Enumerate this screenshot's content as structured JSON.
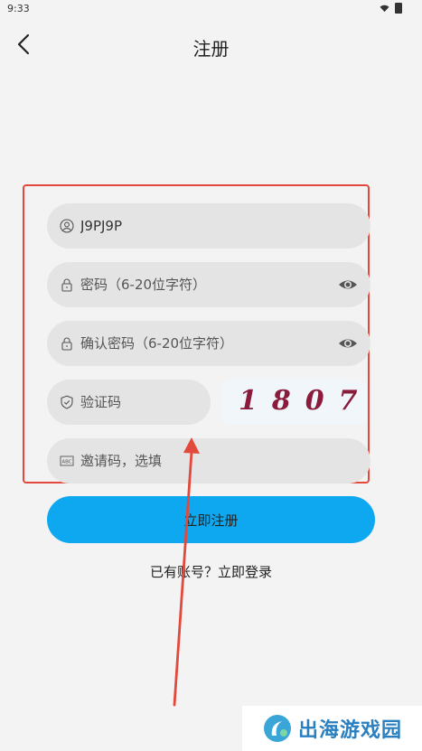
{
  "status": {
    "time": "9:33"
  },
  "header": {
    "title": "注册"
  },
  "form": {
    "username": {
      "value": "J9PJ9P"
    },
    "password": {
      "placeholder": "密码（6-20位字符）"
    },
    "confirm_password": {
      "placeholder": "确认密码（6-20位字符）"
    },
    "verification": {
      "placeholder": "验证码",
      "captcha_text": "1807"
    },
    "invite": {
      "placeholder": "邀请码，选填"
    }
  },
  "actions": {
    "register_label": "立即注册",
    "login_prompt": "已有账号？立即登录"
  },
  "watermark": {
    "text": "出海游戏园"
  },
  "colors": {
    "accent": "#0ea8f0",
    "annotation_red": "#e2483b",
    "captcha": "#8a1b3a"
  }
}
